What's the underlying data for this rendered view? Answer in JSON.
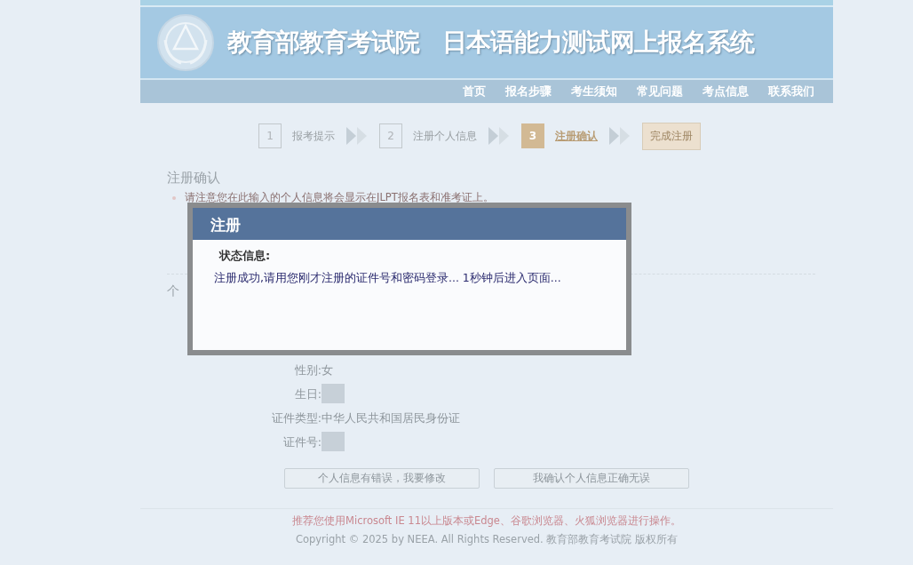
{
  "header": {
    "org_title": "教育部教育考试院",
    "system_title": "日本语能力测试网上报名系统",
    "nav": [
      "首页",
      "报名步骤",
      "考生须知",
      "常见问题",
      "考点信息",
      "联系我们"
    ]
  },
  "steps": [
    {
      "number": "1",
      "label": "报考提示",
      "selected": false
    },
    {
      "number": "2",
      "label": "注册个人信息",
      "selected": false
    },
    {
      "number": "3",
      "label": "注册确认",
      "selected": true
    }
  ],
  "finish_step": "完成注册",
  "section_title": "注册确认",
  "notes": [
    "请注意您在此输入的个人信息将会显示在JLPT报名表和准考证上。"
  ],
  "info_title": "个",
  "fields": [
    {
      "label": "性别:",
      "value": "女",
      "kind": "text"
    },
    {
      "label": "生日:",
      "kind": "blurred"
    },
    {
      "label": "证件类型:",
      "value": "中华人民共和国居民身份证",
      "kind": "text"
    },
    {
      "label": "证件号:",
      "kind": "blurred"
    }
  ],
  "buttons": [
    "个人信息有错误，我要修改",
    "我确认个人信息正确无误"
  ],
  "footer": {
    "browser_note": "推荐您使用Microsoft IE 11以上版本或Edge、谷歌浏览器、火狐浏览器进行操作。",
    "copyright": "Copyright © 2025 by NEEA. All Rights Reserved. 教育部教育考试院 版权所有"
  },
  "dialog": {
    "title": "注册",
    "status_label": "状态信息:",
    "message": "注册成功,请用您刚才注册的证件号和密码登录... 1秒钟后进入页面..."
  }
}
